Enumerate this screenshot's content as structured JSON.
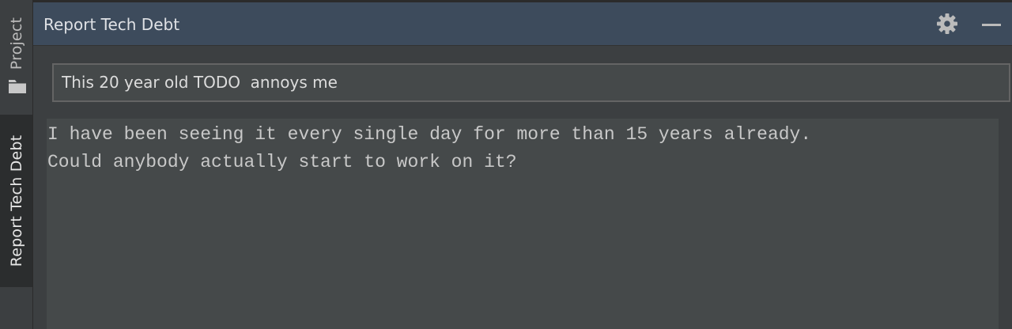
{
  "stripe": {
    "items": [
      {
        "label": "Project",
        "icon": "folder-icon",
        "active": false
      },
      {
        "label": "Report Tech Debt",
        "active": true
      }
    ]
  },
  "window": {
    "title": "Report Tech Debt",
    "icons": {
      "settings": "gear-icon",
      "minimize": "minimize-icon"
    }
  },
  "form": {
    "title_value": "This 20 year old TODO  annoys me",
    "description_value": "I have been seeing it every single day for more than 15 years already.\nCould anybody actually start to work on it?"
  },
  "colors": {
    "header_bg": "#3d4b5c",
    "panel_bg": "#3c3f41",
    "field_bg": "#45494a"
  }
}
